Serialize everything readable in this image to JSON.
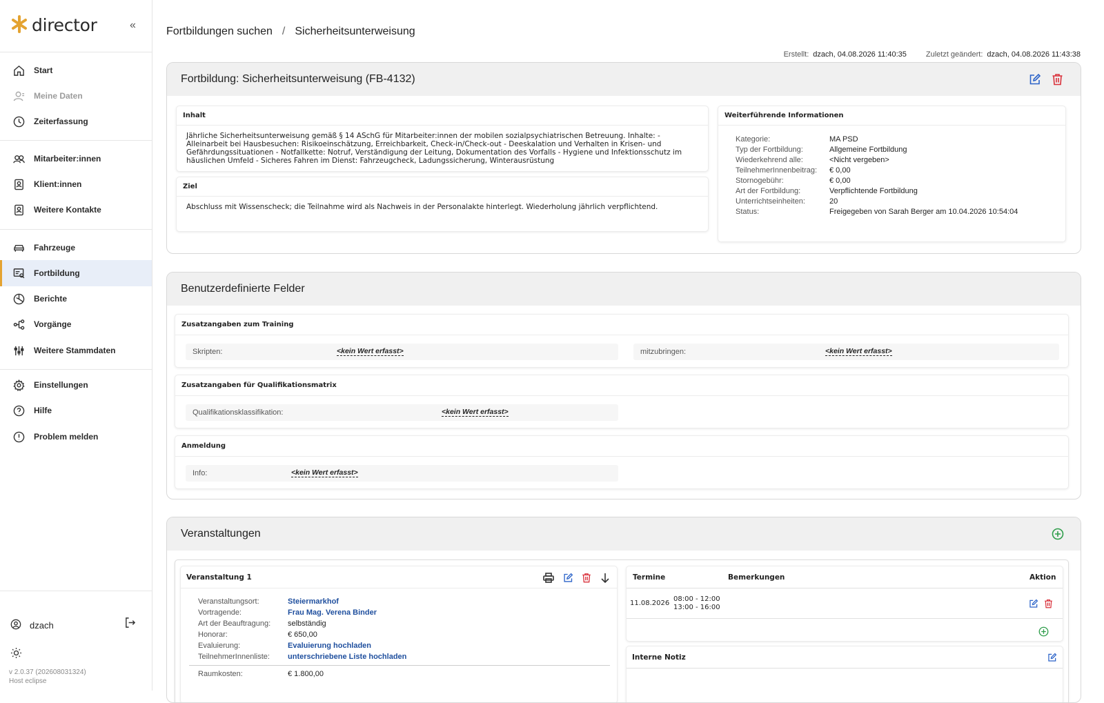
{
  "app": {
    "name": "director"
  },
  "sidebar": {
    "items": [
      {
        "label": "Start",
        "icon": "home-icon"
      },
      {
        "label": "Meine Daten",
        "icon": "user-icon"
      },
      {
        "label": "Zeiterfassung",
        "icon": "clock-icon"
      },
      {
        "label": "Mitarbeiter:innen",
        "icon": "users-icon"
      },
      {
        "label": "Klient:innen",
        "icon": "contact-card-icon"
      },
      {
        "label": "Weitere Kontakte",
        "icon": "contact-card-icon"
      },
      {
        "label": "Fahrzeuge",
        "icon": "car-icon"
      },
      {
        "label": "Fortbildung",
        "icon": "training-icon"
      },
      {
        "label": "Berichte",
        "icon": "chart-icon"
      },
      {
        "label": "Vorgänge",
        "icon": "workflow-icon"
      },
      {
        "label": "Weitere Stammdaten",
        "icon": "sliders-icon"
      },
      {
        "label": "Einstellungen",
        "icon": "gear-icon"
      },
      {
        "label": "Hilfe",
        "icon": "help-icon"
      },
      {
        "label": "Problem melden",
        "icon": "alert-icon"
      }
    ],
    "user": "dzach",
    "version_line1": "v 2.0.37 (202608031324)",
    "version_line2": "Host eclipse"
  },
  "breadcrumb": {
    "parent": "Fortbildungen suchen",
    "separator": "/",
    "current": "Sicherheitsunterweisung"
  },
  "meta": {
    "created_label": "Erstellt:",
    "created_value": "dzach, 04.08.2026 11:40:35",
    "modified_label": "Zuletzt geändert:",
    "modified_value": "dzach, 04.08.2026 11:43:38"
  },
  "training": {
    "title": "Fortbildung: Sicherheitsunterweisung (FB-4132)",
    "content_header": "Inhalt",
    "content_text": "Jährliche Sicherheitsunterweisung gemäß § 14 ASchG für Mitarbeiter:innen der mobilen sozialpsychiatrischen Betreuung. Inhalte: - Alleinarbeit bei Hausbesuchen: Risikoeinschätzung, Erreichbarkeit, Check-in/Check-out - Deeskalation und Verhalten in Krisen- und Gefährdungssituationen - Notfallkette: Notruf, Verständigung der Leitung, Dokumentation des Vorfalls - Hygiene und Infektionsschutz im häuslichen Umfeld - Sicheres Fahren im Dienst: Fahrzeugcheck, Ladungssicherung, Winterausrüstung",
    "goal_header": "Ziel",
    "goal_text": "Abschluss mit Wissenscheck; die Teilnahme wird als Nachweis in der Personalakte hinterlegt. Wiederholung jährlich verpflichtend.",
    "info_header": "Weiterführende Informationen",
    "info": [
      {
        "k": "Kategorie:",
        "v": "MA PSD"
      },
      {
        "k": "Typ der Fortbildung:",
        "v": "Allgemeine Fortbildung"
      },
      {
        "k": "Wiederkehrend alle:",
        "v": "<Nicht vergeben>"
      },
      {
        "k": "TeilnehmerInnenbeitrag:",
        "v": "€ 0,00"
      },
      {
        "k": "Stornogebühr:",
        "v": "€ 0,00"
      },
      {
        "k": "Art der Fortbildung:",
        "v": "Verpflichtende Fortbildung"
      },
      {
        "k": "Unterrichtseinheiten:",
        "v": "20"
      },
      {
        "k": "Status:",
        "v": "Freigegeben von Sarah Berger am 10.04.2026 10:54:04"
      }
    ]
  },
  "custom_fields": {
    "title": "Benutzerdefinierte Felder",
    "section1": "Zusatzangaben zum Training",
    "skripten_label": "Skripten:",
    "mitzubringen_label": "mitzubringen:",
    "section2": "Zusatzangaben für Qualifikationsmatrix",
    "quali_label": "Qualifikationsklassifikation:",
    "section3": "Anmeldung",
    "info_label": "Info:",
    "no_value": "<kein Wert erfasst>"
  },
  "events": {
    "title": "Veranstaltungen",
    "event_title": "Veranstaltung 1",
    "details": [
      {
        "k": "Veranstaltungsort:",
        "v": "Steiermarkhof",
        "link": true
      },
      {
        "k": "Vortragende:",
        "v": "Frau Mag. Verena Binder",
        "link": true
      },
      {
        "k": "Art der Beauftragung:",
        "v": "selbständig",
        "link": false
      },
      {
        "k": "Honorar:",
        "v": "€ 650,00",
        "link": false
      },
      {
        "k": "Evaluierung:",
        "v": "Evaluierung hochladen",
        "link": true
      },
      {
        "k": "TeilnehmerInnenliste:",
        "v": "unterschriebene Liste hochladen",
        "link": true
      }
    ],
    "room_label": "Raumkosten:",
    "room_value": "€ 1.800,00",
    "table": {
      "col_dates": "Termine",
      "col_notes": "Bemerkungen",
      "col_action": "Aktion",
      "date": "11.08.2026",
      "time1": "08:00 - 12:00",
      "time2": "13:00 - 16:00"
    },
    "note_header": "Interne Notiz"
  },
  "colors": {
    "accent": "#e4a331",
    "link": "#1f4f9e",
    "delete": "#d9303a",
    "edit": "#2a62c8",
    "add": "#2e9d4a"
  }
}
